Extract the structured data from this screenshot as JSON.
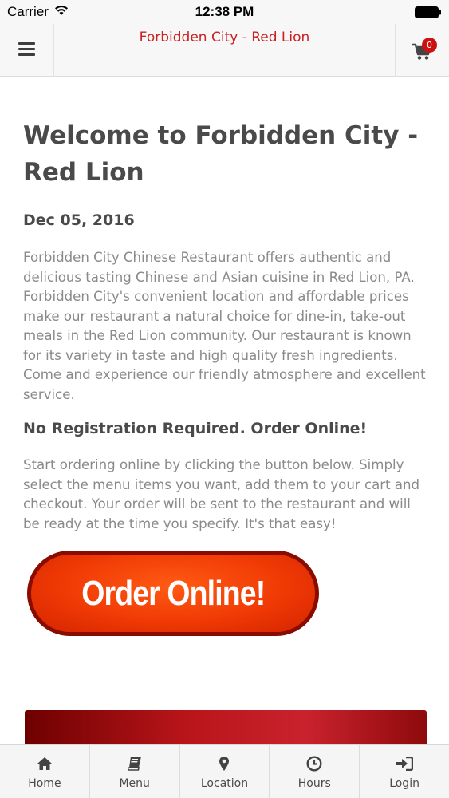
{
  "status_bar": {
    "carrier": "Carrier",
    "time": "12:38 PM"
  },
  "header": {
    "title": "Forbidden City - Red Lion",
    "menu_icon": "hamburger-icon",
    "cart_icon": "cart-icon",
    "cart_count": "0"
  },
  "content": {
    "welcome_title": "Welcome to Forbidden City - Red Lion",
    "date": "Dec 05, 2016",
    "intro": "Forbidden City Chinese Restaurant offers authentic and delicious tasting Chinese and Asian cuisine in Red Lion, PA. Forbidden City's convenient location and affordable prices make our restaurant a natural choice for dine-in, take-out meals in the Red Lion community. Our restaurant is known for its variety in taste and high quality fresh ingredients. Come and experience our friendly atmosphere and excellent service.",
    "registration_heading": "No Registration Required. Order Online!",
    "ordering_text": "Start ordering online by clicking the button below. Simply select the menu items you want, add them to your cart and checkout. Your order will be sent to the restaurant and will be ready at the time you specify. It's that easy!",
    "order_button_label": "Order Online!"
  },
  "tab_bar": {
    "tabs": [
      {
        "label": "Home",
        "icon": "home-icon"
      },
      {
        "label": "Menu",
        "icon": "book-icon"
      },
      {
        "label": "Location",
        "icon": "map-pin-icon"
      },
      {
        "label": "Hours",
        "icon": "clock-icon"
      },
      {
        "label": "Login",
        "icon": "login-icon"
      }
    ]
  },
  "colors": {
    "accent_red": "#cc1f1f",
    "badge_red": "#cc1111",
    "heading_gray": "#4a4a4a",
    "body_gray": "#8a8a8a",
    "order_button_orange": "#f03a05"
  }
}
